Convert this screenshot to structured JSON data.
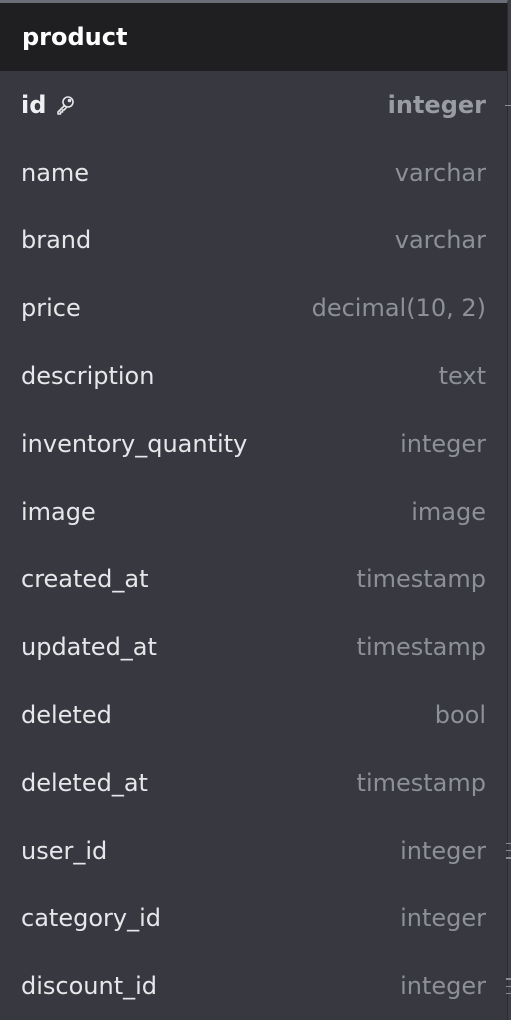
{
  "table": {
    "name": "product",
    "fields": [
      {
        "name": "id",
        "type": "integer",
        "primary_key": true
      },
      {
        "name": "name",
        "type": "varchar"
      },
      {
        "name": "brand",
        "type": "varchar"
      },
      {
        "name": "price",
        "type": "decimal(10, 2)"
      },
      {
        "name": "description",
        "type": "text"
      },
      {
        "name": "inventory_quantity",
        "type": "integer"
      },
      {
        "name": "image",
        "type": "image"
      },
      {
        "name": "created_at",
        "type": "timestamp"
      },
      {
        "name": "updated_at",
        "type": "timestamp"
      },
      {
        "name": "deleted",
        "type": "bool"
      },
      {
        "name": "deleted_at",
        "type": "timestamp"
      },
      {
        "name": "user_id",
        "type": "integer",
        "relation_handle": true
      },
      {
        "name": "category_id",
        "type": "integer"
      },
      {
        "name": "discount_id",
        "type": "integer",
        "relation_handle": true
      }
    ]
  },
  "colors": {
    "header_bg": "#1f1f21",
    "body_bg": "#373840",
    "field_name": "#e7e7ea",
    "field_type": "#8e9099"
  },
  "icons": {
    "primary_key": "key-icon",
    "relation": "connector-handle-icon"
  }
}
